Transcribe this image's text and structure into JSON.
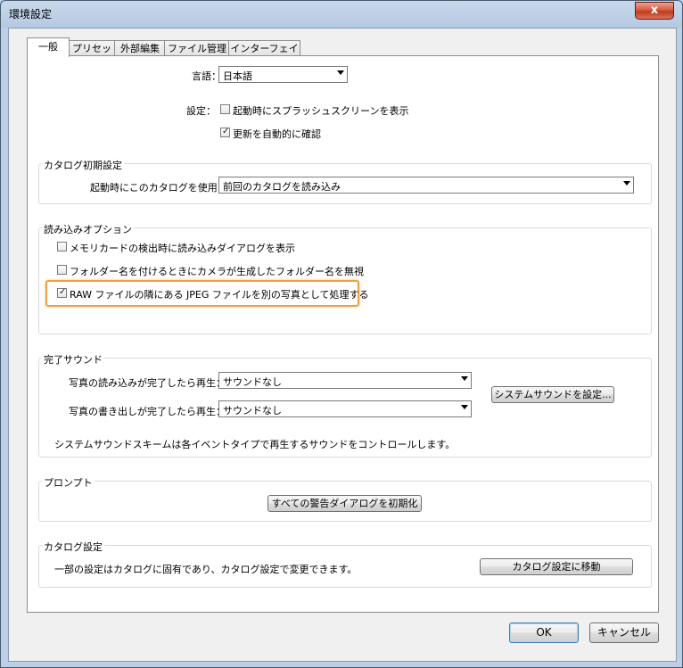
{
  "window": {
    "title": "環境設定",
    "close_label": "x"
  },
  "tabs": [
    "一般",
    "プリセット",
    "外部編集",
    "ファイル管理",
    "インターフェイス"
  ],
  "general": {
    "language_label": "言語：",
    "language_value": "日本語",
    "settings_label": "設定：",
    "splash_label": "起動時にスプラッシュスクリーンを表示",
    "splash_checked": false,
    "update_label": "更新を自動的に確認",
    "update_checked": true
  },
  "catalog_defaults": {
    "title": "カタログ初期設定",
    "use_label": "起動時にこのカタログを使用：",
    "use_value": "前回のカタログを読み込み"
  },
  "import_options": {
    "title": "読み込みオプション",
    "memory_card_label": "メモリカードの検出時に読み込みダイアログを表示",
    "memory_card_checked": false,
    "folder_name_label": "フォルダー名を付けるときにカメラが生成したフォルダー名を無視",
    "folder_name_checked": false,
    "raw_jpeg_label": "RAW ファイルの隣にある JPEG ファイルを別の写真として処理する",
    "raw_jpeg_checked": true
  },
  "completion_sounds": {
    "title": "完了サウンド",
    "import_label": "写真の読み込みが完了したら再生：",
    "import_value": "サウンドなし",
    "export_label": "写真の書き出しが完了したら再生：",
    "export_value": "サウンドなし",
    "system_sound_button": "システムサウンドを設定...",
    "note": "システムサウンドスキームは各イベントタイプで再生するサウンドをコントロールします。"
  },
  "prompts": {
    "title": "プロンプト",
    "reset_button": "すべての警告ダイアログを初期化"
  },
  "catalog_settings": {
    "title": "カタログ設定",
    "note": "一部の設定はカタログに固有であり、カタログ設定で変更できます。",
    "goto_button": "カタログ設定に移動"
  },
  "footer": {
    "ok": "OK",
    "cancel": "キャンセル"
  },
  "colors": {
    "highlight": "#f0a044",
    "titlebar": "#b9d1ea",
    "close": "#c13a1e"
  }
}
